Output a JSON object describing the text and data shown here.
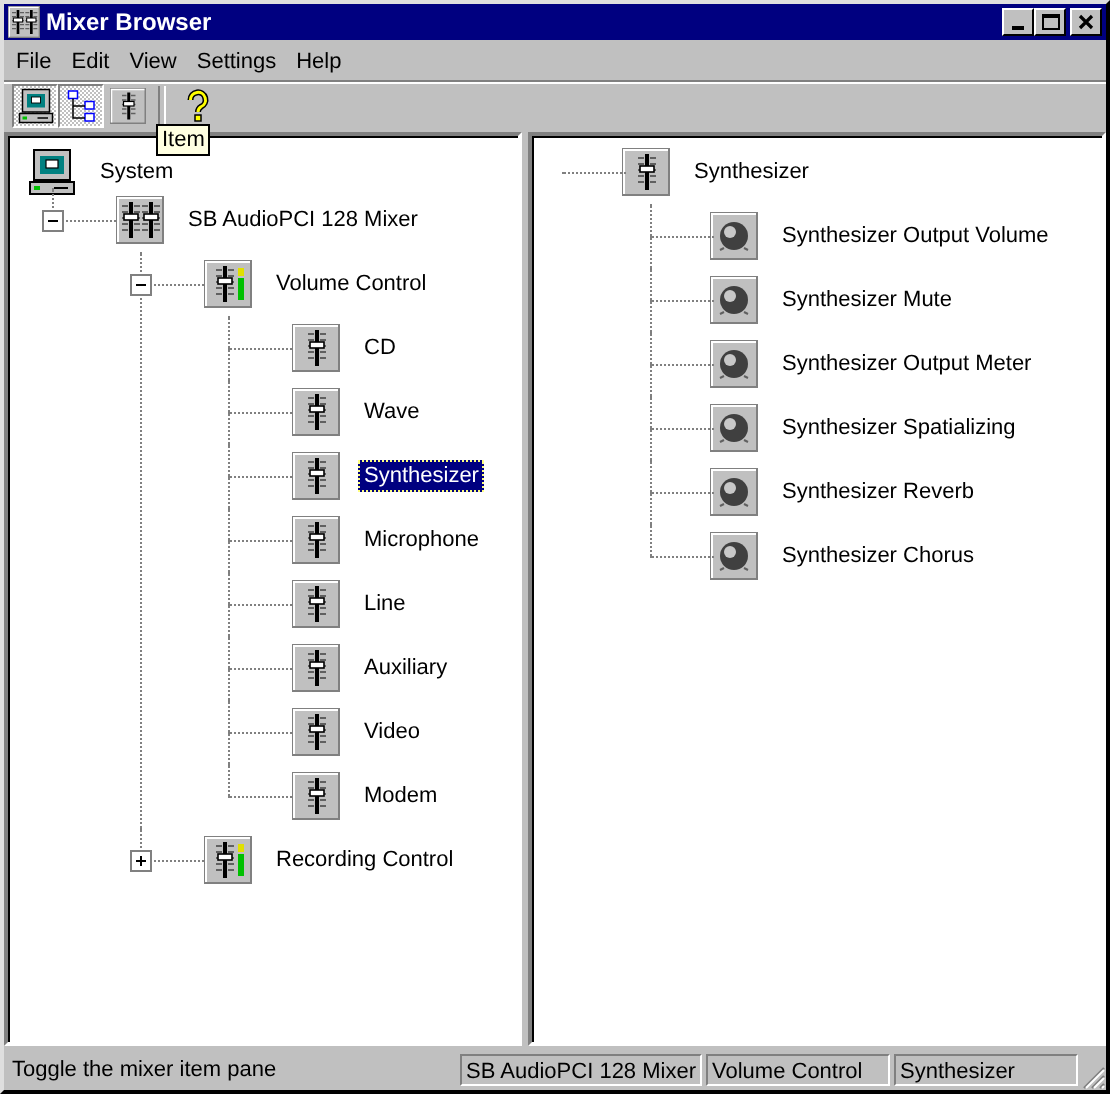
{
  "window": {
    "title": "Mixer Browser"
  },
  "menu": [
    "File",
    "Edit",
    "View",
    "Settings",
    "Help"
  ],
  "toolbar": {
    "buttons": [
      {
        "kind": "computer",
        "pressed": true,
        "separator_before": false
      },
      {
        "kind": "tree",
        "pressed": true,
        "separator_before": false
      },
      {
        "kind": "fader",
        "pressed": false,
        "separator_before": false
      },
      {
        "kind": "help",
        "pressed": false,
        "separator_before": true
      }
    ],
    "tooltip": "Item"
  },
  "tree": {
    "label": "System",
    "kind": "computer",
    "selected": false,
    "children": [
      {
        "label": "SB AudioPCI 128 Mixer",
        "kind": "mixer",
        "selected": false,
        "expanded": true,
        "children": [
          {
            "label": "Volume Control",
            "kind": "meter-fader",
            "selected": false,
            "expanded": true,
            "children": [
              {
                "label": "CD",
                "kind": "fader",
                "selected": false
              },
              {
                "label": "Wave",
                "kind": "fader",
                "selected": false
              },
              {
                "label": "Synthesizer",
                "kind": "fader",
                "selected": true
              },
              {
                "label": "Microphone",
                "kind": "fader",
                "selected": false
              },
              {
                "label": "Line",
                "kind": "fader",
                "selected": false
              },
              {
                "label": "Auxiliary",
                "kind": "fader",
                "selected": false
              },
              {
                "label": "Video",
                "kind": "fader",
                "selected": false
              },
              {
                "label": "Modem",
                "kind": "fader",
                "selected": false
              }
            ]
          },
          {
            "label": "Recording Control",
            "kind": "meter-fader",
            "selected": false,
            "expanded": false
          }
        ]
      }
    ]
  },
  "detail": {
    "label": "Synthesizer",
    "kind": "fader",
    "selected": false,
    "children": [
      {
        "label": "Synthesizer Output Volume",
        "kind": "knob",
        "selected": false
      },
      {
        "label": "Synthesizer Mute",
        "kind": "knob",
        "selected": false
      },
      {
        "label": "Synthesizer Output Meter",
        "kind": "knob",
        "selected": false
      },
      {
        "label": "Synthesizer Spatializing",
        "kind": "knob",
        "selected": false
      },
      {
        "label": "Synthesizer Reverb",
        "kind": "knob",
        "selected": false
      },
      {
        "label": "Synthesizer Chorus",
        "kind": "knob",
        "selected": false
      }
    ]
  },
  "status_bar": [
    "Toggle the mixer item pane",
    "SB AudioPCI 128 Mixer",
    "Volume Control",
    "Synthesizer"
  ]
}
